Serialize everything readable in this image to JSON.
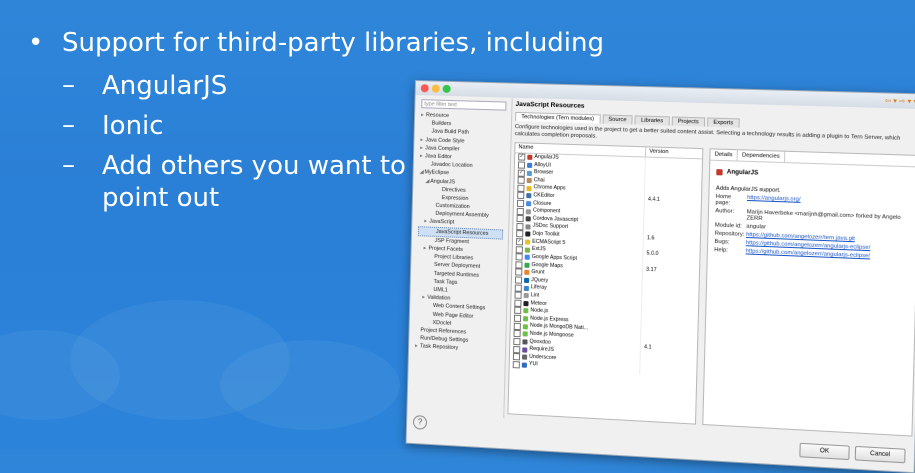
{
  "slide": {
    "bullet_glyph": "•",
    "dash_glyph": "–",
    "main_bullet": "Support for third-party libraries, including",
    "sub_bullets": [
      "AngularJS",
      "Ionic",
      "Add others you want to point out"
    ]
  },
  "window": {
    "filter_placeholder": "type filter text",
    "tree": [
      {
        "label": "Resource",
        "indent": 0,
        "arrow": "▸"
      },
      {
        "label": "Builders",
        "indent": 1
      },
      {
        "label": "Java Build Path",
        "indent": 1
      },
      {
        "label": "Java Code Style",
        "indent": 0,
        "arrow": "▸"
      },
      {
        "label": "Java Compiler",
        "indent": 0,
        "arrow": "▸"
      },
      {
        "label": "Java Editor",
        "indent": 0,
        "arrow": "▸"
      },
      {
        "label": "Javadoc Location",
        "indent": 1
      },
      {
        "label": "MyEclipse",
        "indent": 0,
        "arrow": "◢"
      },
      {
        "label": "AngularJS",
        "indent": 1,
        "arrow": "◢"
      },
      {
        "label": "Directives",
        "indent": 3
      },
      {
        "label": "Expression",
        "indent": 3
      },
      {
        "label": "Customization",
        "indent": 2
      },
      {
        "label": "Deployment Assembly",
        "indent": 2
      },
      {
        "label": "JavaScript",
        "indent": 1,
        "arrow": "▸"
      },
      {
        "label": "JavaScript Resources",
        "indent": 2,
        "selected": true
      },
      {
        "label": "JSP Fragment",
        "indent": 2
      },
      {
        "label": "Project Facets",
        "indent": 1,
        "arrow": "▸"
      },
      {
        "label": "Project Libraries",
        "indent": 2
      },
      {
        "label": "Server Deployment",
        "indent": 2
      },
      {
        "label": "Targeted Runtimes",
        "indent": 2
      },
      {
        "label": "Task Tags",
        "indent": 2
      },
      {
        "label": "UML1",
        "indent": 2
      },
      {
        "label": "Validation",
        "indent": 1,
        "arrow": "▸"
      },
      {
        "label": "Web Content Settings",
        "indent": 2
      },
      {
        "label": "Web Page Editor",
        "indent": 2
      },
      {
        "label": "XDoclet",
        "indent": 2
      },
      {
        "label": "Project References",
        "indent": 0
      },
      {
        "label": "Run/Debug Settings",
        "indent": 0
      },
      {
        "label": "Task Repository",
        "indent": 0,
        "arrow": "▸"
      }
    ],
    "right_title": "JavaScript Resources",
    "tabs": [
      {
        "label": "Technologies (Tern modules)",
        "active": true
      },
      {
        "label": "Source"
      },
      {
        "label": "Libraries"
      },
      {
        "label": "Projects"
      },
      {
        "label": "Exports"
      }
    ],
    "description": "Configure technologies used in the project to get a better suited content assist. Selecting a technology results in adding a plugin to Tern Server, which calculates completion proposals.",
    "columns": {
      "name": "Name",
      "version": "Version"
    },
    "libraries": [
      {
        "name": "AngularJS",
        "version": "",
        "checked": true,
        "color": "#c0392b"
      },
      {
        "name": "AlloyUI",
        "version": "",
        "checked": false,
        "color": "#3a7bd5"
      },
      {
        "name": "Browser",
        "version": "",
        "checked": true,
        "color": "#5b9bd5"
      },
      {
        "name": "Chai",
        "version": "",
        "checked": false,
        "color": "#b58b5a"
      },
      {
        "name": "Chrome Apps",
        "version": "",
        "checked": false,
        "color": "#e8b822"
      },
      {
        "name": "CKEditor",
        "version": "4.4.1",
        "checked": false,
        "color": "#3d6fa8"
      },
      {
        "name": "Closure",
        "version": "",
        "checked": false,
        "color": "#4a89dc"
      },
      {
        "name": "Component",
        "version": "",
        "checked": false,
        "color": "#999999"
      },
      {
        "name": "Cordova Javascript",
        "version": "",
        "checked": false,
        "color": "#444444"
      },
      {
        "name": "JSDoc Support",
        "version": "",
        "checked": false,
        "color": "#888888"
      },
      {
        "name": "Dojo Toolkit",
        "version": "1.6",
        "checked": false,
        "color": "#222222"
      },
      {
        "name": "ECMAScript 5",
        "version": "",
        "checked": true,
        "color": "#e6c229"
      },
      {
        "name": "ExtJS",
        "version": "5.0.0",
        "checked": false,
        "color": "#7cb342"
      },
      {
        "name": "Google Apps Script",
        "version": "",
        "checked": false,
        "color": "#4285f4"
      },
      {
        "name": "Google Maps",
        "version": "3.17",
        "checked": false,
        "color": "#34a853"
      },
      {
        "name": "Grunt",
        "version": "",
        "checked": false,
        "color": "#e48632"
      },
      {
        "name": "JQuery",
        "version": "",
        "checked": false,
        "color": "#0769ad"
      },
      {
        "name": "Liferay",
        "version": "",
        "checked": false,
        "color": "#3d85c6"
      },
      {
        "name": "Lint",
        "version": "",
        "checked": false,
        "color": "#999999"
      },
      {
        "name": "Meteor",
        "version": "",
        "checked": false,
        "color": "#222222"
      },
      {
        "name": "Node.js",
        "version": "",
        "checked": false,
        "color": "#6cc04a"
      },
      {
        "name": "Node.js Express",
        "version": "",
        "checked": false,
        "color": "#6cc04a"
      },
      {
        "name": "Node.js MongoDB Nati...",
        "version": "",
        "checked": false,
        "color": "#6cc04a"
      },
      {
        "name": "Node.js Mongoose",
        "version": "",
        "checked": false,
        "color": "#6cc04a"
      },
      {
        "name": "Qooxdoo",
        "version": "4.1",
        "checked": false,
        "color": "#555555"
      },
      {
        "name": "RequireJS",
        "version": "",
        "checked": false,
        "color": "#6b4c9a"
      },
      {
        "name": "Underscore",
        "version": "",
        "checked": false,
        "color": "#666666"
      },
      {
        "name": "YUI",
        "version": "",
        "checked": false,
        "color": "#2d6cc0"
      }
    ],
    "details_tabs": [
      "Details",
      "Dependencies"
    ],
    "details": {
      "name": "AngularJS",
      "support": "Adds AngularJS support.",
      "home_label": "Home page:",
      "home": "https://angularjs.org/",
      "author_label": "Author:",
      "author": "Marijn Haverbeke <marijnh@gmail.com> forked by Angelo ZERR",
      "module_label": "Module id:",
      "module": "angular",
      "repo_label": "Repository:",
      "repo": "https://github.com/angelozerr/tern.java.git",
      "bugs_label": "Bugs:",
      "bugs": "https://github.com/angelozerr/angularjs-eclipse/",
      "help_label": "Help:",
      "help": "https://github.com/angelozerr/angularjs-eclipse/"
    },
    "help_glyph": "?",
    "ok_label": "OK",
    "cancel_label": "Cancel",
    "colors": {
      "accent": "#2a7fd6",
      "link": "#1a56c7",
      "light_red": "#fc5753",
      "light_yellow": "#fdbc40",
      "light_green": "#33c748"
    }
  }
}
